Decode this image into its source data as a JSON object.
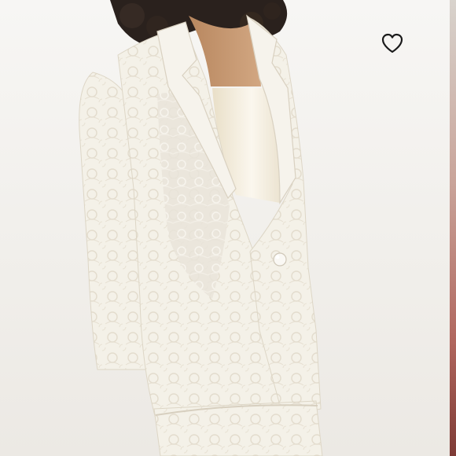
{
  "photo": {
    "icon": "lace-blazer-photo"
  },
  "favorite": {
    "icon": "heart-outline-icon",
    "stroke_color": "#1a1a1a",
    "label": ""
  },
  "colors": {
    "background": "#f3f1ed",
    "blazer": "#f4f1e8",
    "camisole": "#f1ead8",
    "skin": "#c99a76",
    "hair": "#2a211d",
    "edge_strip": "#b0665e"
  }
}
